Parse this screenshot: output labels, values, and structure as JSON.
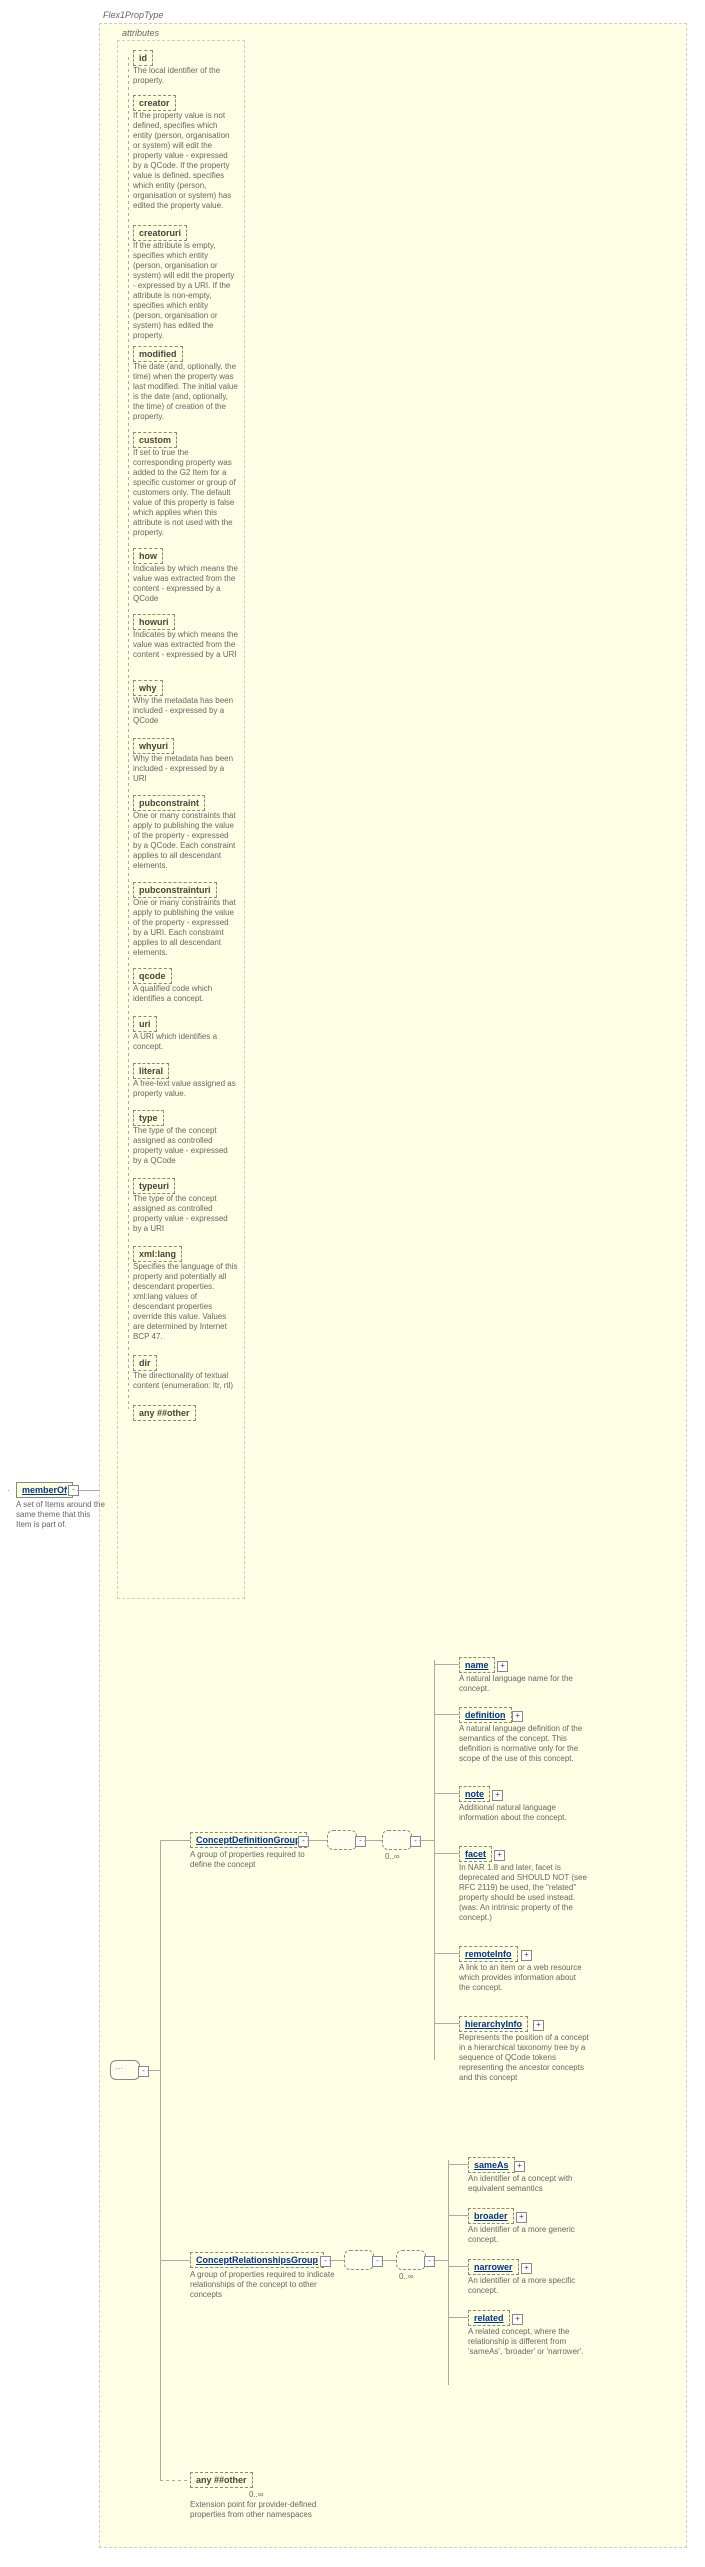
{
  "typeName": "Flex1PropType",
  "root": {
    "name": "memberOf",
    "desc": "A set of Items around the same theme that this Item is part of."
  },
  "attributesLabel": "attributes",
  "attributes": [
    {
      "name": "id",
      "desc": "The local identifier of the property."
    },
    {
      "name": "creator",
      "desc": "If the property value is not defined, specifies which entity (person, organisation or system) will edit the property value - expressed by a QCode. If the property value is defined, specifies which entity (person, organisation or system) has edited the property value."
    },
    {
      "name": "creatoruri",
      "desc": "If the attribute is empty, specifies which entity (person, organisation or system) will edit the property - expressed by a URI. If the attribute is non-empty, specifies which entity (person, organisation or system) has edited the property."
    },
    {
      "name": "modified",
      "desc": "The date (and, optionally, the time) when the property was last modified. The initial value is the date (and, optionally, the time) of creation of the property."
    },
    {
      "name": "custom",
      "desc": "If set to true the corresponding property was added to the G2 Item for a specific customer or group of customers only. The default value of this property is false which applies when this attribute is not used with the property."
    },
    {
      "name": "how",
      "desc": "Indicates by which means the value was extracted from the content - expressed by a QCode"
    },
    {
      "name": "howuri",
      "desc": "Indicates by which means the value was extracted from the content - expressed by a URI"
    },
    {
      "name": "why",
      "desc": "Why the metadata has been included - expressed by a QCode"
    },
    {
      "name": "whyuri",
      "desc": "Why the metadata has been included - expressed by a URI"
    },
    {
      "name": "pubconstraint",
      "desc": "One or many constraints that apply to publishing the value of the property - expressed by a QCode. Each constraint applies to all descendant elements."
    },
    {
      "name": "pubconstrainturi",
      "desc": "One or many constraints that apply to publishing the value of the property - expressed by a URI. Each constraint applies to all descendant elements."
    },
    {
      "name": "qcode",
      "desc": "A qualified code which identifies a concept."
    },
    {
      "name": "uri",
      "desc": "A URI which identifies a concept."
    },
    {
      "name": "literal",
      "desc": "A free-text value assigned as property value."
    },
    {
      "name": "type",
      "desc": "The type of the concept assigned as controlled property value - expressed by a QCode"
    },
    {
      "name": "typeuri",
      "desc": "The type of the concept assigned as controlled property value - expressed by a URI"
    },
    {
      "name": "xml:lang",
      "desc": "Specifies the language of this property and potentially all descendant properties. xml:lang values of descendant properties override this value. Values are determined by Internet BCP 47."
    },
    {
      "name": "dir",
      "desc": "The directionality of textual content (enumeration: ltr, rtl)"
    }
  ],
  "wildcardAttr": "any ##other",
  "groups": {
    "definition": {
      "name": "ConceptDefinitionGroup",
      "desc": "A group of properties required to define the concept",
      "occ": "0..∞",
      "children": [
        {
          "name": "name",
          "desc": "A natural language name for the concept.",
          "plus": true
        },
        {
          "name": "definition",
          "desc": "A natural language definition of the semantics of the concept. This definition is normative only for the scope of the use of this concept.",
          "plus": true
        },
        {
          "name": "note",
          "desc": "Additional natural language information about the concept.",
          "plus": true
        },
        {
          "name": "facet",
          "desc": "In NAR 1.8 and later, facet is deprecated and SHOULD NOT (see RFC 2119) be used, the \"related\" property should be used instead.(was: An intrinsic property of the concept.)",
          "plus": true
        },
        {
          "name": "remoteInfo",
          "desc": "A link to an item or a web resource which provides information about the concept.",
          "plus": true
        },
        {
          "name": "hierarchyInfo",
          "desc": "Represents the position of a concept in a hierarchical taxonomy tree by a sequence of QCode tokens representing the ancestor concepts and this concept",
          "plus": true
        }
      ]
    },
    "relationships": {
      "name": "ConceptRelationshipsGroup",
      "desc": "A group of properties required to indicate relationships of the concept to other concepts",
      "occ": "0..∞",
      "children": [
        {
          "name": "sameAs",
          "desc": "An identifier of a concept with equivalent semantics",
          "plus": true
        },
        {
          "name": "broader",
          "desc": "An identifier of a more generic concept.",
          "plus": true
        },
        {
          "name": "narrower",
          "desc": "An identifier of a more specific concept.",
          "plus": true
        },
        {
          "name": "related",
          "desc": "A related concept, where the relationship is different from 'sameAs', 'broader' or 'narrower'.",
          "plus": true
        }
      ]
    }
  },
  "ext": {
    "name": "any ##other",
    "desc": "Extension point for provider-defined properties from other namespaces",
    "occ": "0..∞"
  }
}
